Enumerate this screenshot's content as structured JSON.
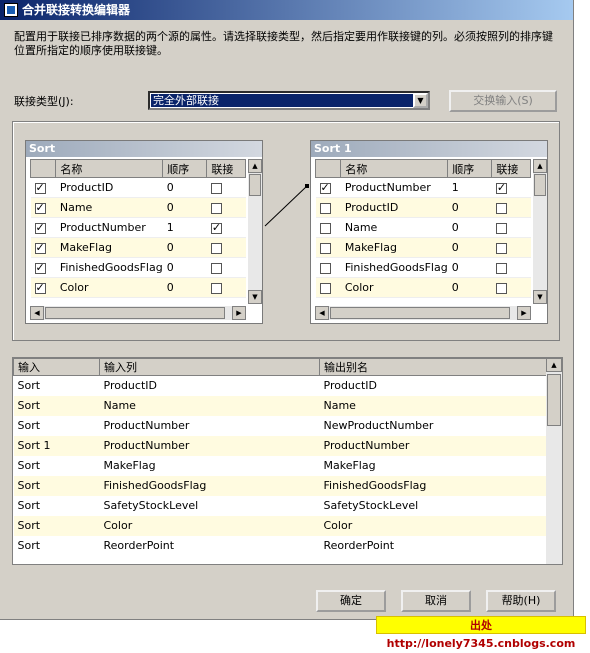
{
  "window": {
    "title": "合并联接转换编辑器"
  },
  "description": "配置用于联接已排序数据的两个源的属性。请选择联接类型，然后指定要用作联接键的列。必须按照列的排序键位置所指定的顺序使用联接键。",
  "join_type": {
    "label": "联接类型(J):",
    "value": "完全外部联接"
  },
  "swap_button": "交换输入(S)",
  "sources": [
    {
      "title": "Sort",
      "columns": [
        "名称",
        "顺序",
        "联接"
      ],
      "rows": [
        {
          "checked": true,
          "name": "ProductID",
          "order": "0",
          "join": false
        },
        {
          "checked": true,
          "name": "Name",
          "order": "0",
          "join": false
        },
        {
          "checked": true,
          "name": "ProductNumber",
          "order": "1",
          "join": true
        },
        {
          "checked": true,
          "name": "MakeFlag",
          "order": "0",
          "join": false
        },
        {
          "checked": true,
          "name": "FinishedGoodsFlag",
          "order": "0",
          "join": false
        },
        {
          "checked": true,
          "name": "Color",
          "order": "0",
          "join": false
        }
      ]
    },
    {
      "title": "Sort 1",
      "columns": [
        "名称",
        "顺序",
        "联接"
      ],
      "rows": [
        {
          "checked": true,
          "name": "ProductNumber",
          "order": "1",
          "join": true
        },
        {
          "checked": false,
          "name": "ProductID",
          "order": "0",
          "join": false
        },
        {
          "checked": false,
          "name": "Name",
          "order": "0",
          "join": false
        },
        {
          "checked": false,
          "name": "MakeFlag",
          "order": "0",
          "join": false
        },
        {
          "checked": false,
          "name": "FinishedGoodsFlag",
          "order": "0",
          "join": false
        },
        {
          "checked": false,
          "name": "Color",
          "order": "0",
          "join": false
        }
      ]
    }
  ],
  "mapping": {
    "columns": [
      "输入",
      "输入列",
      "输出别名"
    ],
    "rows": [
      [
        "Sort",
        "ProductID",
        "ProductID"
      ],
      [
        "Sort",
        "Name",
        "Name"
      ],
      [
        "Sort",
        "ProductNumber",
        "NewProductNumber"
      ],
      [
        "Sort 1",
        "ProductNumber",
        "ProductNumber"
      ],
      [
        "Sort",
        "MakeFlag",
        "MakeFlag"
      ],
      [
        "Sort",
        "FinishedGoodsFlag",
        "FinishedGoodsFlag"
      ],
      [
        "Sort",
        "SafetyStockLevel",
        "SafetyStockLevel"
      ],
      [
        "Sort",
        "Color",
        "Color"
      ],
      [
        "Sort",
        "ReorderPoint",
        "ReorderPoint"
      ]
    ]
  },
  "buttons": {
    "ok": "确定",
    "cancel": "取消",
    "help": "帮助(H)"
  },
  "watermark": "出处http://lonely7345.cnblogs.com"
}
